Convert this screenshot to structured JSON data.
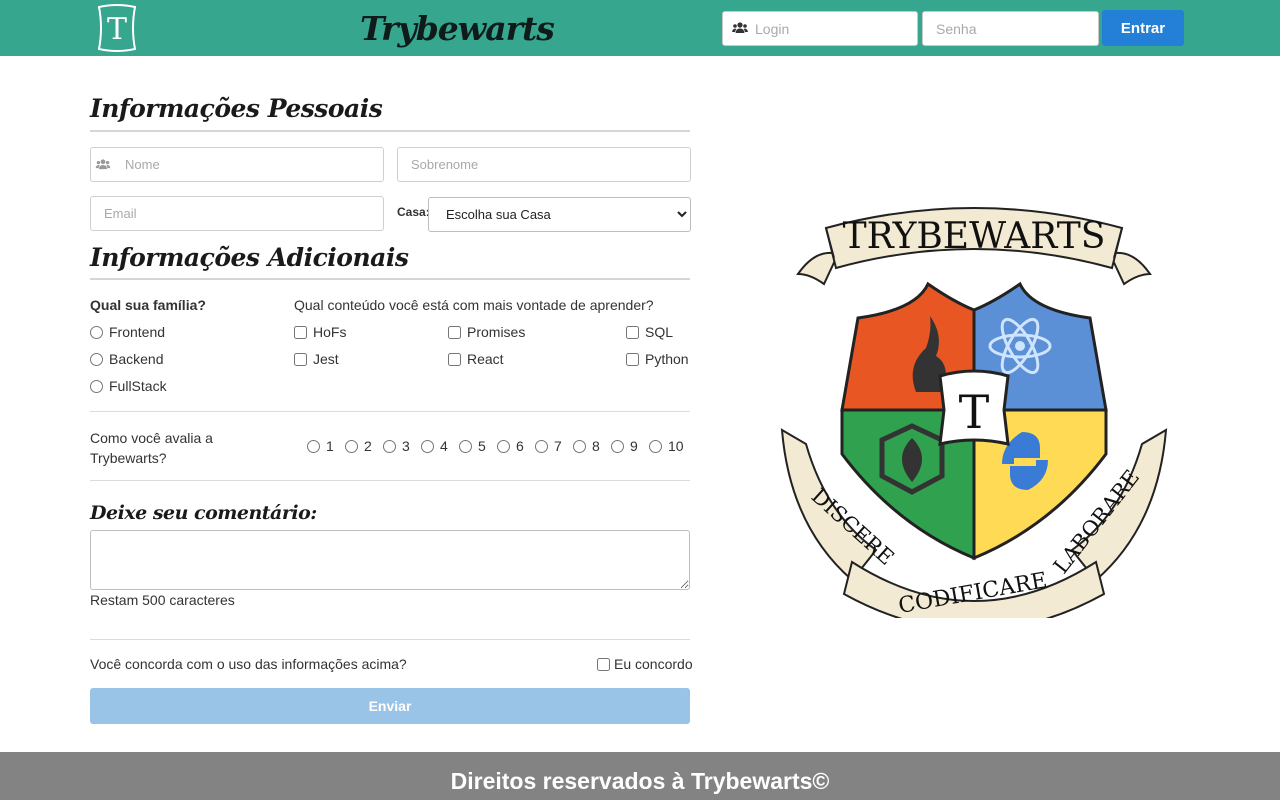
{
  "header": {
    "logo_letter": "T",
    "brand": "Trybewarts",
    "login_placeholder": "Login",
    "password_placeholder": "Senha",
    "enter_button": "Entrar"
  },
  "personal": {
    "title": "Informações Pessoais",
    "name_placeholder": "Nome",
    "surname_placeholder": "Sobrenome",
    "email_placeholder": "Email",
    "house_label": "Casa:",
    "house_selected": "Escolha sua Casa"
  },
  "additional": {
    "title": "Informações Adicionais",
    "family_question": "Qual sua família?",
    "families": [
      "Frontend",
      "Backend",
      "FullStack"
    ],
    "content_question": "Qual conteúdo você está com mais vontade de aprender?",
    "contents": [
      "HoFs",
      "Promises",
      "SQL",
      "Jest",
      "React",
      "Python"
    ],
    "rating_question_line1": "Como você avalia a",
    "rating_question_line2": "Trybewarts?",
    "ratings": [
      "1",
      "2",
      "3",
      "4",
      "5",
      "6",
      "7",
      "8",
      "9",
      "10"
    ]
  },
  "comment": {
    "title": "Deixe seu comentário:",
    "counter": "Restam 500 caracteres"
  },
  "agreement": {
    "question": "Você concorda com o uso das informações acima?",
    "checkbox_label": "Eu concordo",
    "submit": "Enviar"
  },
  "crest": {
    "top_banner": "TRYBEWARTS",
    "center_letter": "T",
    "motto_left": "DISCERE",
    "motto_center": "CODIFICARE",
    "motto_right": "LABORARE"
  },
  "footer": {
    "text": "Direitos reservados à Trybewarts©"
  },
  "colors": {
    "header": "#36a68f",
    "primary_button": "#2480d6",
    "disabled_button": "#99c4e8",
    "footer": "#838383",
    "crest_orange": "#e85624",
    "crest_blue": "#5b8fd6",
    "crest_green": "#2fa14f",
    "crest_yellow": "#ffdb55"
  }
}
